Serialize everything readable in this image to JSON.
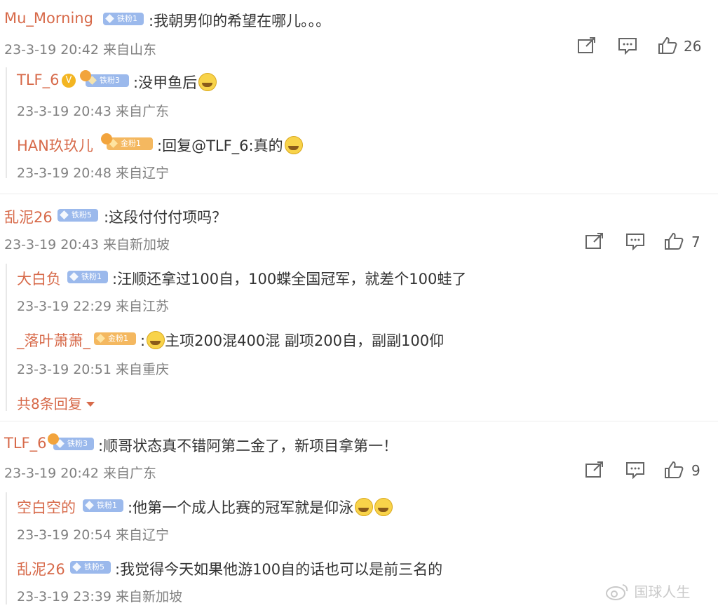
{
  "comments": [
    {
      "user": "Mu_Morning",
      "badge": "铁粉1",
      "text": ":我朝男仰的希望在哪儿。。。",
      "meta": "23-3-19 20:42 来自山东",
      "likes": "26",
      "replies": [
        {
          "user": "TLF_6",
          "badge": "铁粉3",
          "text": ":没甲鱼后",
          "meta": "23-3-19 20:43 来自广东"
        },
        {
          "user": "HAN玖玖儿",
          "badge": "金粉1",
          "text": ":回复@TLF_6:真的",
          "meta": "23-3-19 20:48 来自辽宁"
        }
      ]
    },
    {
      "user": "乱泥26",
      "badge": "铁粉5",
      "text": ":这段付付付项吗？",
      "meta": "23-3-19 20:43 来自新加坡",
      "likes": "7",
      "replies": [
        {
          "user": "大白负",
          "badge": "铁粉1",
          "text": ":汪顺还拿过100自，100蝶全国冠军，就差个100蛙了",
          "meta": "23-3-19 22:29 来自江苏"
        },
        {
          "user": "_落叶萧萧_",
          "badge": "金粉1",
          "text": "主项200混400混 副项200自，副副100仰",
          "meta": "23-3-19 20:51 来自重庆"
        }
      ],
      "more_replies": "共8条回复"
    },
    {
      "user": "TLF_6",
      "badge": "铁粉3",
      "text": ":顺哥状态真不错阿第二金了，新项目拿第一！",
      "meta": "23-3-19 20:42 来自广东",
      "likes": "9",
      "replies": [
        {
          "user": "空白空的",
          "badge": "铁粉1",
          "text": ":他第一个成人比赛的冠军就是仰泳",
          "meta": "23-3-19 20:54 来自辽宁"
        },
        {
          "user": "乱泥26",
          "badge": "铁粉5",
          "text": ":我觉得今天如果他游100自的话也可以是前三名的",
          "meta": "23-3-19 23:39 来自新加坡"
        }
      ]
    }
  ],
  "watermark": "国球人生",
  "icons": {
    "share": "share-icon",
    "comment": "comment-icon",
    "like": "like-icon",
    "emoji": "laugh-cry-emoji-icon",
    "verified": "verified-icon"
  },
  "colors": {
    "username": "#d76a4a",
    "meta": "#808080",
    "badge_blue": "#9bb9ec",
    "badge_gold": "#f4b860"
  }
}
